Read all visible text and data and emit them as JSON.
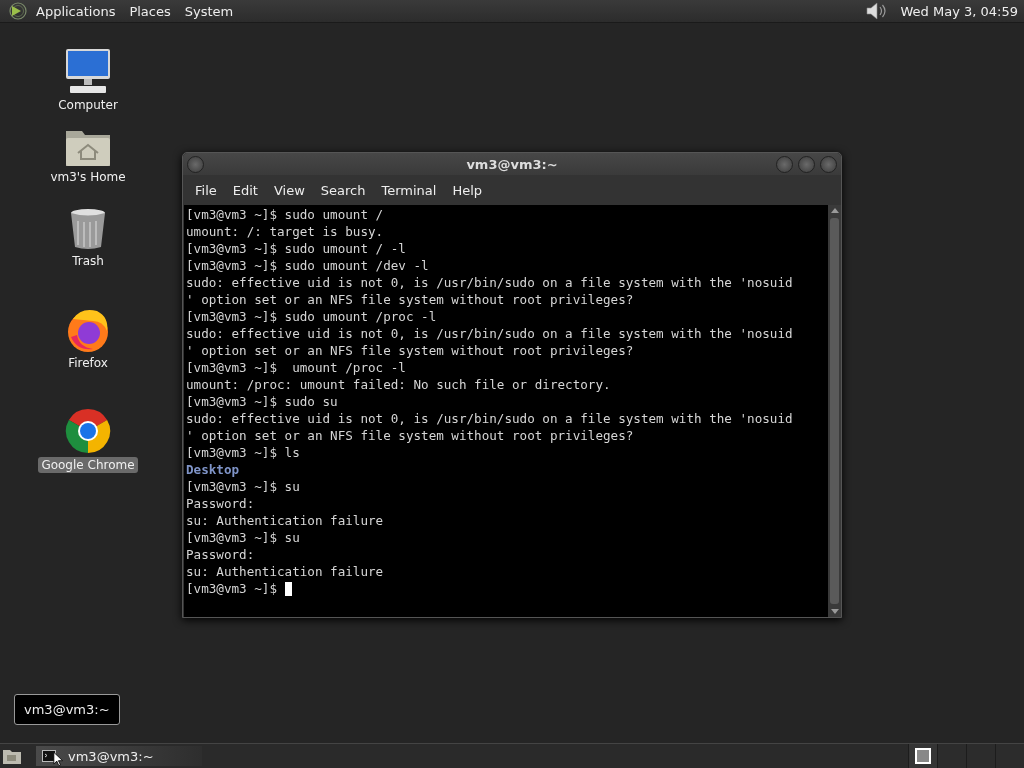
{
  "top_panel": {
    "menus": [
      "Applications",
      "Places",
      "System"
    ],
    "clock": "Wed May  3, 04:59"
  },
  "desktop_icons": [
    {
      "kind": "computer",
      "label": "Computer",
      "selected": false
    },
    {
      "kind": "home",
      "label": "vm3's Home",
      "selected": false
    },
    {
      "kind": "trash",
      "label": "Trash",
      "selected": false
    },
    {
      "kind": "firefox",
      "label": "Firefox",
      "selected": false
    },
    {
      "kind": "chrome",
      "label": "Google Chrome",
      "selected": true
    }
  ],
  "window": {
    "title": "vm3@vm3:~",
    "menus": [
      "File",
      "Edit",
      "View",
      "Search",
      "Terminal",
      "Help"
    ],
    "lines": [
      {
        "kind": "text",
        "text": "[vm3@vm3 ~]$ sudo umount /"
      },
      {
        "kind": "text",
        "text": "umount: /: target is busy."
      },
      {
        "kind": "text",
        "text": "[vm3@vm3 ~]$ sudo umount / -l"
      },
      {
        "kind": "text",
        "text": "[vm3@vm3 ~]$ sudo umount /dev -l"
      },
      {
        "kind": "text",
        "text": "sudo: effective uid is not 0, is /usr/bin/sudo on a file system with the 'nosuid"
      },
      {
        "kind": "text",
        "text": "' option set or an NFS file system without root privileges?"
      },
      {
        "kind": "text",
        "text": "[vm3@vm3 ~]$ sudo umount /proc -l"
      },
      {
        "kind": "text",
        "text": "sudo: effective uid is not 0, is /usr/bin/sudo on a file system with the 'nosuid"
      },
      {
        "kind": "text",
        "text": "' option set or an NFS file system without root privileges?"
      },
      {
        "kind": "text",
        "text": "[vm3@vm3 ~]$  umount /proc -l"
      },
      {
        "kind": "text",
        "text": "umount: /proc: umount failed: No such file or directory."
      },
      {
        "kind": "text",
        "text": "[vm3@vm3 ~]$ sudo su"
      },
      {
        "kind": "text",
        "text": "sudo: effective uid is not 0, is /usr/bin/sudo on a file system with the 'nosuid"
      },
      {
        "kind": "text",
        "text": "' option set or an NFS file system without root privileges?"
      },
      {
        "kind": "text",
        "text": "[vm3@vm3 ~]$ ls"
      },
      {
        "kind": "dir",
        "text": "Desktop"
      },
      {
        "kind": "text",
        "text": "[vm3@vm3 ~]$ su"
      },
      {
        "kind": "text",
        "text": "Password:"
      },
      {
        "kind": "text",
        "text": "su: Authentication failure"
      },
      {
        "kind": "text",
        "text": "[vm3@vm3 ~]$ su"
      },
      {
        "kind": "text",
        "text": "Password:"
      },
      {
        "kind": "text",
        "text": "su: Authentication failure"
      },
      {
        "kind": "text",
        "text": "[vm3@vm3 ~]$ ",
        "cursor": true
      }
    ]
  },
  "tooltip": "vm3@vm3:~",
  "taskbar": {
    "tasks": [
      {
        "label": "vm3@vm3:~",
        "selected": true
      }
    ],
    "workspaces": [
      {
        "selected": true
      },
      {
        "selected": false
      },
      {
        "selected": false
      },
      {
        "selected": false
      }
    ]
  }
}
